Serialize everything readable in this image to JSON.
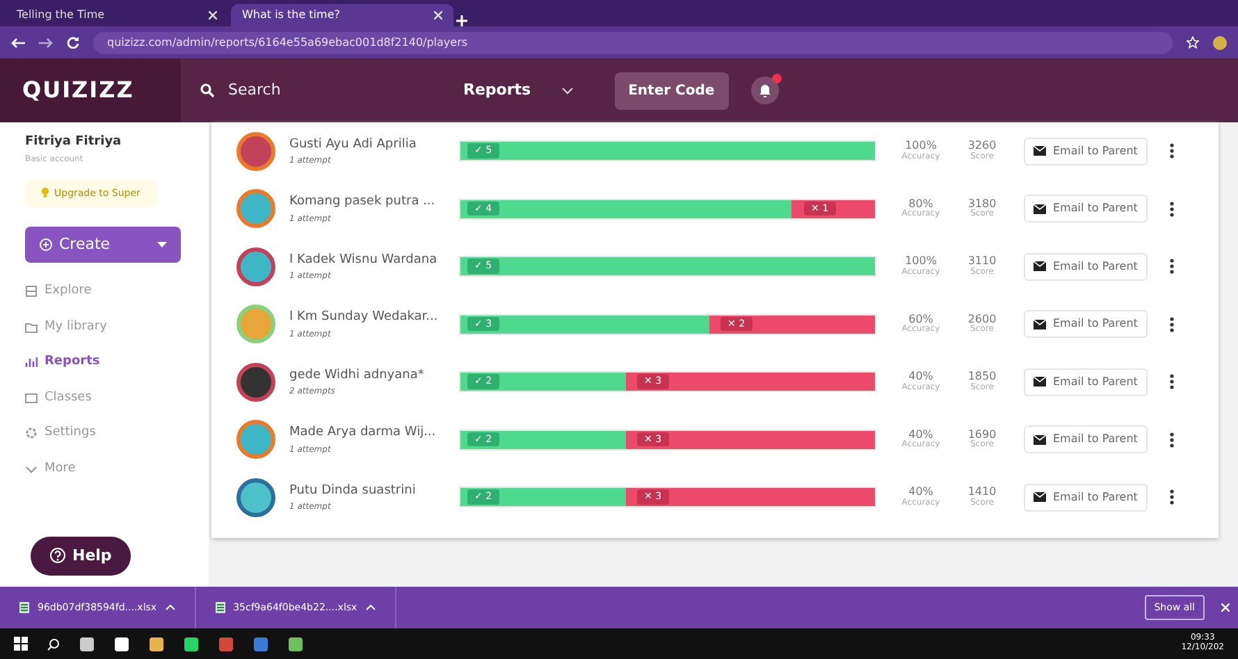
{
  "browser": {
    "tabs": [
      {
        "label": "Telling the Time",
        "selected": false
      },
      {
        "label": "What is the time?",
        "selected": true
      }
    ],
    "address": "quizizz.com/admin/reports/6164e55a69ebac001d8f2140/players"
  },
  "header": {
    "logo": "QUIZIZZ",
    "search": {
      "placeholder": "Search"
    },
    "menu": "Reports",
    "enter_code": "Enter Code"
  },
  "sidebar": {
    "user": "Fitriya Fitriya",
    "account": "Basic account",
    "upgrade": "Upgrade to Super",
    "create": "Create",
    "items": [
      {
        "label": "Explore",
        "selected": false
      },
      {
        "label": "My library",
        "selected": false
      },
      {
        "label": "Reports",
        "selected": true
      },
      {
        "label": "Classes",
        "selected": false
      },
      {
        "label": "Settings",
        "selected": false
      },
      {
        "label": "More",
        "selected": false
      }
    ],
    "help": "Help"
  },
  "players": [
    {
      "name": "Gusti Ayu Adi Aprilia",
      "attempts": "1 attempt",
      "correct": "✓ 5",
      "level": 1,
      "accuracy": "100%",
      "accuracy_label": "Accuracy",
      "score": "3260",
      "score_label": "Score",
      "email": "Email to Parent"
    },
    {
      "name": "Komang pasek putra ...",
      "attempts": "1 attempt",
      "correct": "✓ 4",
      "wrong": "✕ 1",
      "level": 0.8,
      "accuracy": "80%",
      "accuracy_label": "Accuracy",
      "score": "3180",
      "score_label": "Score",
      "email": "Email to Parent"
    },
    {
      "name": "I Kadek Wisnu Wardana",
      "attempts": "1 attempt",
      "correct": "✓ 5",
      "level": 1,
      "accuracy": "100%",
      "accuracy_label": "Accuracy",
      "score": "3110",
      "score_label": "Score",
      "email": "Email to Parent"
    },
    {
      "name": "I Km Sunday Wedakar...",
      "attempts": "1 attempt",
      "correct": "✓ 3",
      "wrong": "✕ 2",
      "level": 0.6,
      "accuracy": "60%",
      "accuracy_label": "Accuracy",
      "score": "2600",
      "score_label": "Score",
      "email": "Email to Parent"
    },
    {
      "name": "gede Widhi adnyana*",
      "attempts": "2 attempts",
      "correct": "✓ 2",
      "wrong": "✕ 3",
      "level": 0.4,
      "accuracy": "40%",
      "accuracy_label": "Accuracy",
      "score": "1850",
      "score_label": "Score",
      "email": "Email to Parent"
    },
    {
      "name": "Made Arya darma Wij...",
      "attempts": "1 attempt",
      "correct": "✓ 2",
      "wrong": "✕ 3",
      "level": 0.4,
      "accuracy": "40%",
      "accuracy_label": "Accuracy",
      "score": "1690",
      "score_label": "Score",
      "email": "Email to Parent"
    },
    {
      "name": "Putu Dinda suastrini",
      "attempts": "1 attempt",
      "correct": "✓ 2",
      "wrong": "✕ 3",
      "level": 0.4,
      "accuracy": "40%",
      "accuracy_label": "Accuracy",
      "score": "1410",
      "score_label": "Score",
      "email": "Email to Parent"
    }
  ],
  "downloads": {
    "files": [
      "96db07df38594fd....xlsx",
      "35cf9a64f0be4b22....xlsx"
    ],
    "show_all": "Show all"
  },
  "taskbar": {
    "time": "09:33",
    "date": "12/10/202"
  }
}
